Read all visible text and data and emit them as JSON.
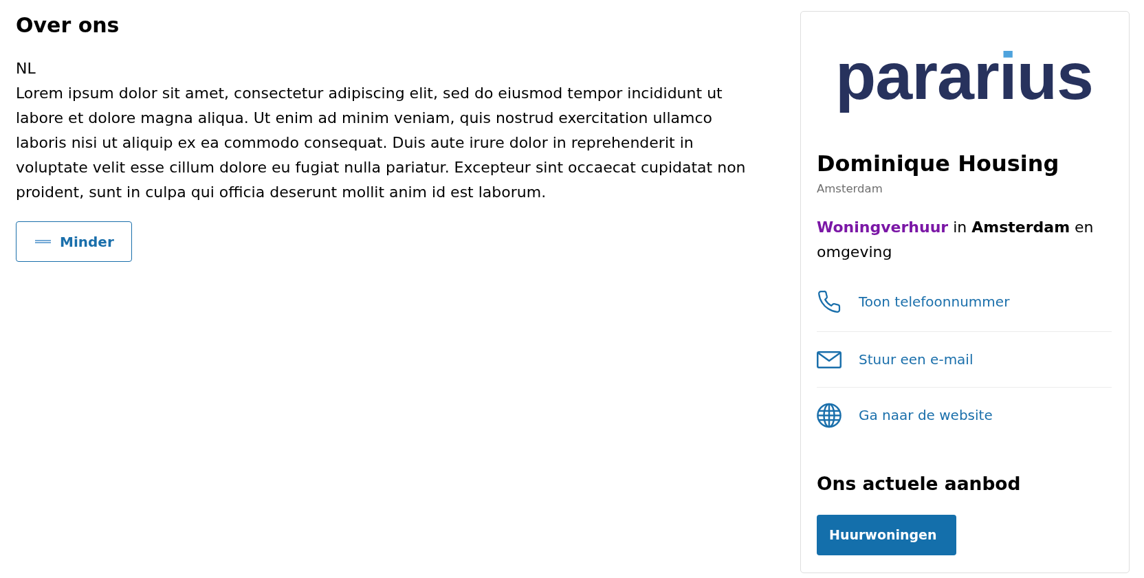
{
  "about": {
    "title": "Over ons",
    "language": "NL",
    "text": "Lorem ipsum dolor sit amet, consectetur adipiscing elit, sed do eiusmod tempor incididunt ut labore et dolore magna aliqua. Ut enim ad minim veniam, quis nostrud exercitation ullamco laboris nisi ut aliquip ex ea commodo consequat. Duis aute irure dolor in reprehenderit in voluptate velit esse cillum dolore eu fugiat nulla pariatur. Excepteur sint occaecat cupidatat non proident, sunt in culpa qui officia deserunt mollit anim id est laborum.",
    "toggle_button": {
      "label": "Minder",
      "expanded": true
    }
  },
  "agent": {
    "logo": "pararius",
    "name": "Dominique Housing",
    "city": "Amsterdam",
    "tagline": {
      "link": "Woningverhuur",
      "visited": true,
      "text": "in **Amsterdam** en omgeving"
    },
    "contacts": [
      {
        "kind": "phone",
        "label": "Toon telefoonnummer"
      },
      {
        "kind": "email",
        "label": "Stuur een e-mail"
      },
      {
        "kind": "website",
        "label": "Ga naar de website"
      }
    ],
    "offer": {
      "title": "Ons actuele aanbod",
      "buttons": [
        {
          "label": "Huurwoningen"
        }
      ]
    }
  }
}
